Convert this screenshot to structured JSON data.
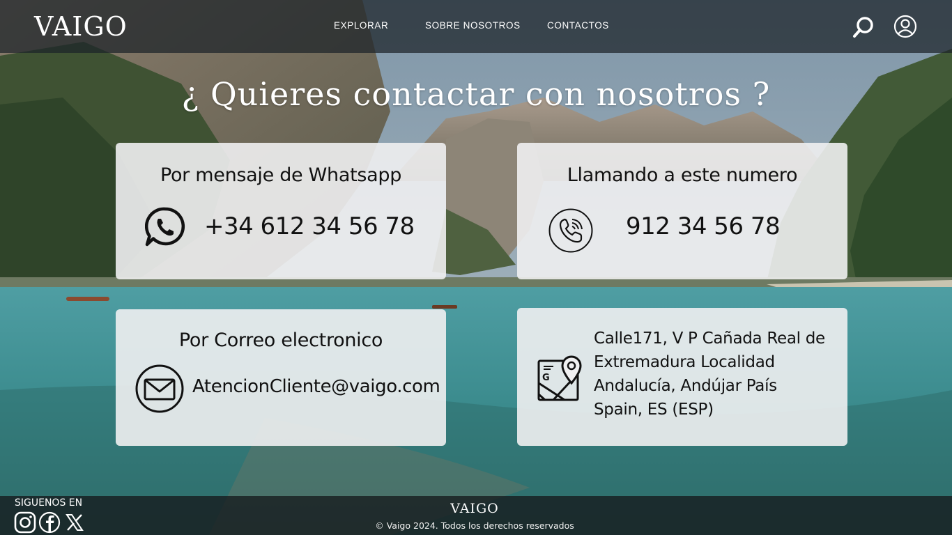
{
  "header": {
    "logo": "VAIGO",
    "nav": {
      "explorar": "EXPLORAR",
      "sobre_nosotros": "SOBRE NOSOTROS",
      "contactos": "CONTACTOS"
    },
    "icons": {
      "search": "search-icon",
      "user": "user-circle-icon"
    }
  },
  "main": {
    "title": "¿ Quieres contactar con nosotros ?",
    "whatsapp": {
      "heading": "Por mensaje de Whatsapp",
      "value": "+34 612 34 56 78",
      "icon": "whatsapp-icon"
    },
    "phone": {
      "heading": "Llamando a este numero",
      "value": "912 34 56 78",
      "icon": "phone-call-icon"
    },
    "email": {
      "heading": "Por Correo electronico",
      "value": "AtencionCliente@vaigo.com",
      "icon": "mail-icon"
    },
    "address": {
      "lines": [
        "Calle171, V P Cañada Real de",
        "Extremadura Localidad",
        "Andalucía, Andújar País",
        "Spain, ES (ESP)"
      ],
      "icon": "map-location-icon"
    }
  },
  "footer": {
    "follow_label": "SIGUENOS EN",
    "social": [
      "instagram-icon",
      "facebook-icon",
      "x-icon"
    ],
    "logo": "VAIGO",
    "copyright": "© Vaigo 2024. Todos los derechos reservados"
  },
  "colors": {
    "card_bg": "#f0f0f1",
    "text_dark": "#111111",
    "header_bg": "#1c2228",
    "white": "#ffffff"
  }
}
